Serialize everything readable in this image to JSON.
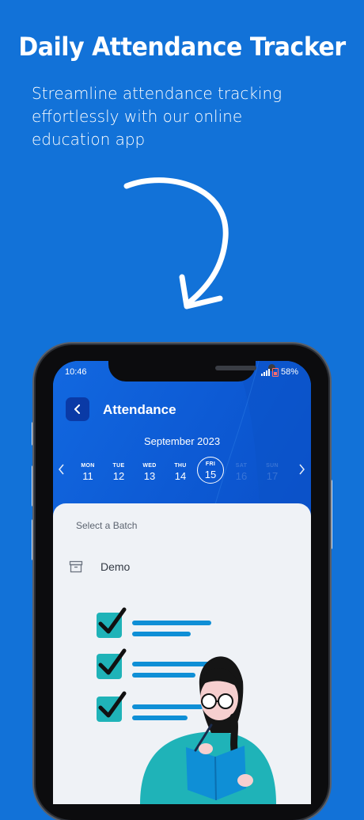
{
  "promo": {
    "title": "Daily Attendance Tracker",
    "subtitle": "Streamline attendance tracking effortlessly with our online education app"
  },
  "status_bar": {
    "time": "10:46",
    "battery": "58%"
  },
  "header": {
    "title": "Attendance",
    "month": "September 2023"
  },
  "calendar": {
    "days": [
      {
        "dow": "MON",
        "num": "11",
        "state": "normal"
      },
      {
        "dow": "TUE",
        "num": "12",
        "state": "normal"
      },
      {
        "dow": "WED",
        "num": "13",
        "state": "normal"
      },
      {
        "dow": "THU",
        "num": "14",
        "state": "normal"
      },
      {
        "dow": "FRI",
        "num": "15",
        "state": "selected"
      },
      {
        "dow": "SAT",
        "num": "16",
        "state": "disabled"
      },
      {
        "dow": "SUN",
        "num": "17",
        "state": "disabled"
      }
    ]
  },
  "batch": {
    "label": "Select a Batch",
    "items": [
      {
        "name": "Demo",
        "icon": "archive-icon"
      }
    ]
  },
  "colors": {
    "background": "#1272d8",
    "accent": "#0a3aa6",
    "check_box": "#1fb3b8",
    "sheet": "#eff2f6"
  }
}
